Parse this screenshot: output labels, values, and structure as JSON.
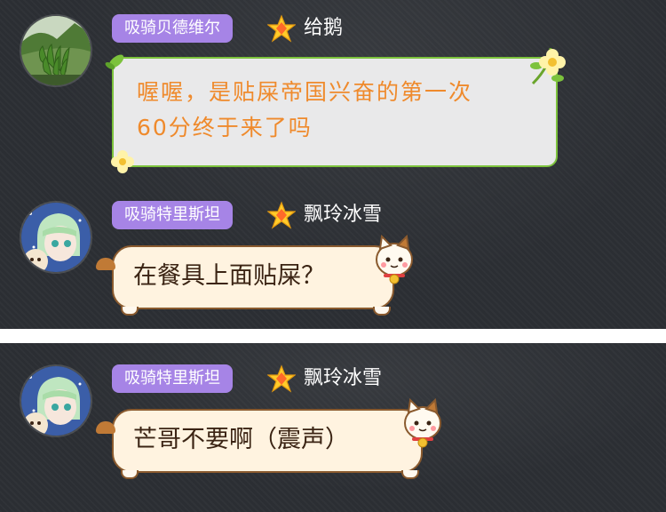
{
  "messages": [
    {
      "title": "吸骑贝德维尔",
      "username": "给鹅",
      "text_line1": "喔喔，是贴屎帝国兴奋的第一次",
      "text_line2": "60分终于来了吗",
      "bubble_style": "green-floral",
      "avatar": "banana-avatar"
    },
    {
      "title": "吸骑特里斯坦",
      "username": "飘玲冰雪",
      "text": "在餐具上面贴屎？",
      "bubble_style": "lucky-cat",
      "avatar": "anime-girl-avatar"
    },
    {
      "title": "吸骑特里斯坦",
      "username": "飘玲冰雪",
      "text": "芒哥不要啊（震声）",
      "bubble_style": "lucky-cat",
      "avatar": "anime-girl-avatar"
    }
  ],
  "colors": {
    "background": "#2b2e33",
    "divider": "#ffffff",
    "title_badge": "#a684e6",
    "green_bubble_border": "#7cc23c",
    "green_bubble_text": "#ef8a2c",
    "cat_bubble_fill": "#fff3e0",
    "cat_bubble_text": "#3b2414"
  }
}
